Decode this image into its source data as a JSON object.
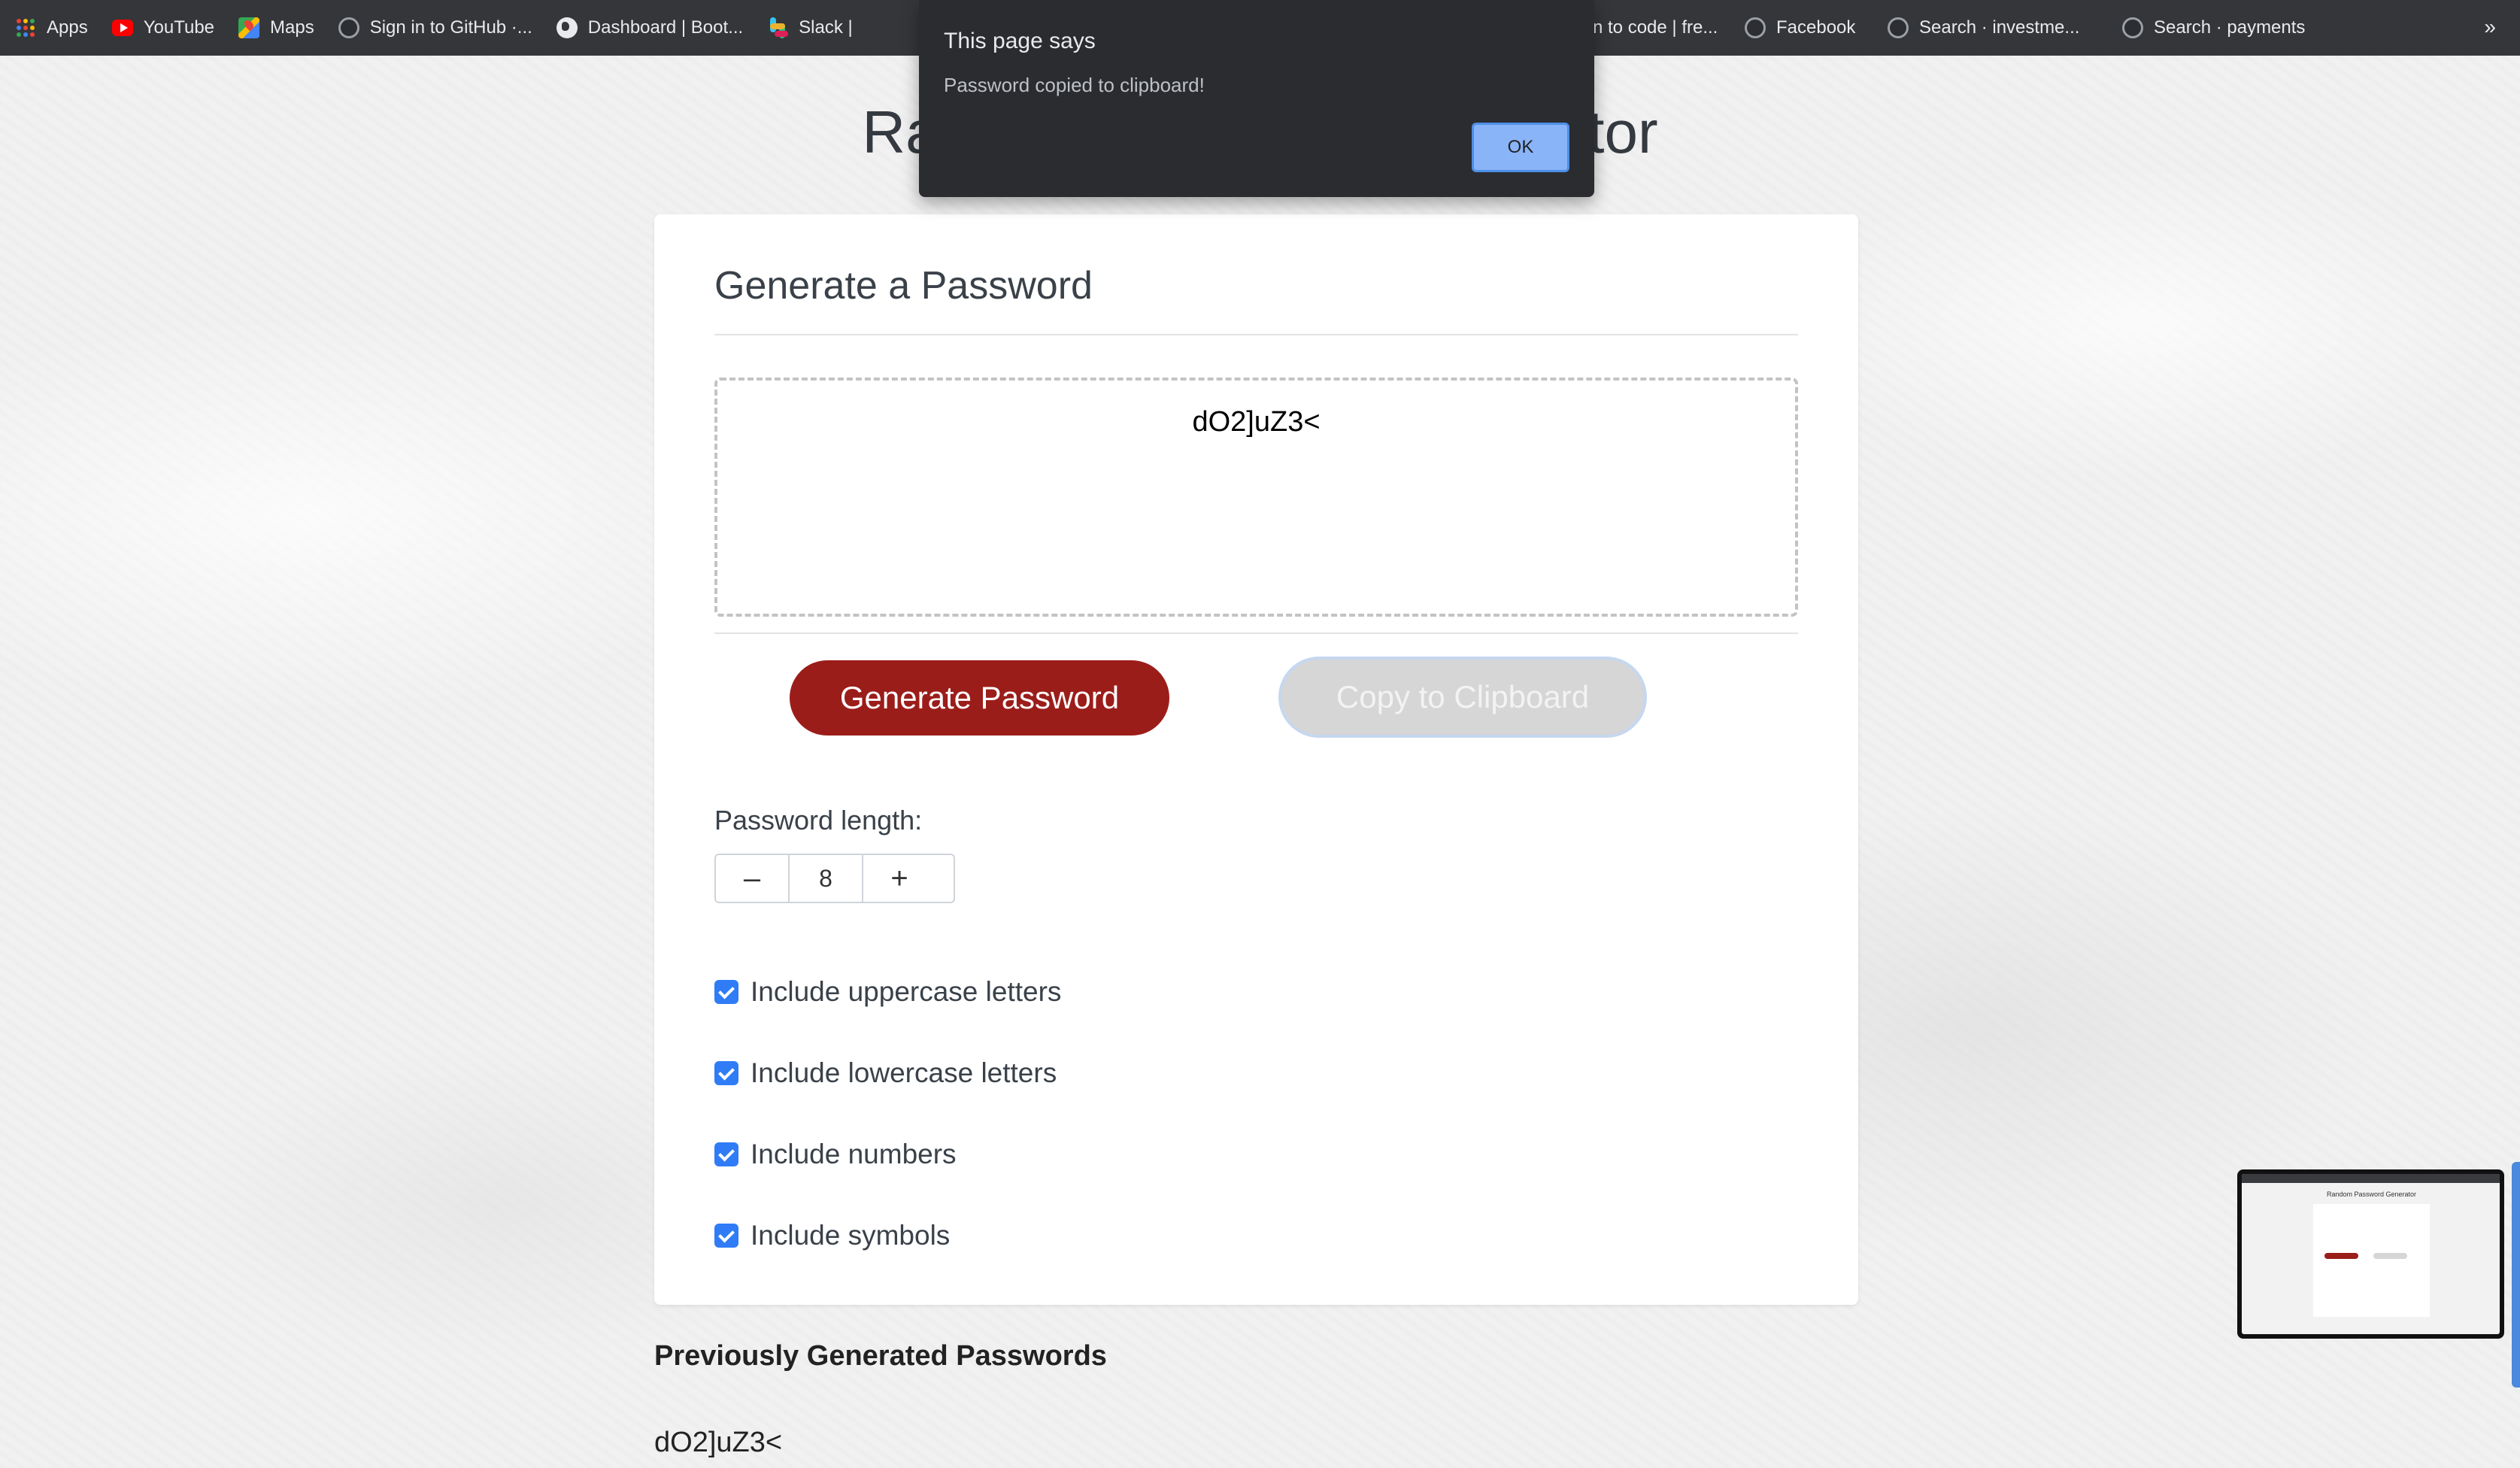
{
  "bookmarks": [
    {
      "label": "Apps",
      "icon": "apps-grid-icon"
    },
    {
      "label": "YouTube",
      "icon": "youtube-icon"
    },
    {
      "label": "Maps",
      "icon": "maps-icon"
    },
    {
      "label": "Sign in to GitHub ·...",
      "icon": "github-icon"
    },
    {
      "label": "Dashboard | Boot...",
      "icon": "globe-icon"
    },
    {
      "label": "Slack |",
      "icon": "slack-icon"
    },
    {
      "label": "n to code | fre...",
      "icon": "github-icon"
    },
    {
      "label": "Facebook",
      "icon": "github-icon"
    },
    {
      "label": "Search · investme...",
      "icon": "github-icon"
    },
    {
      "label": "Search · payments",
      "icon": "github-icon"
    }
  ],
  "bookmarks_more": "»",
  "page": {
    "title": "Random Password Generator"
  },
  "card": {
    "title": "Generate a Password",
    "generated_password": "dO2]uZ3<",
    "generate_button": "Generate Password",
    "copy_button": "Copy to Clipboard",
    "length_label": "Password length:",
    "length_value": "8",
    "minus": "–",
    "plus": "+",
    "options": [
      {
        "label": "Include uppercase letters",
        "checked": true
      },
      {
        "label": "Include lowercase letters",
        "checked": true
      },
      {
        "label": "Include numbers",
        "checked": true
      },
      {
        "label": "Include symbols",
        "checked": true
      }
    ]
  },
  "history": {
    "title": "Previously Generated Passwords",
    "items": [
      "dO2]uZ3<"
    ]
  },
  "dialog": {
    "title": "This page says",
    "message": "Password copied to clipboard!",
    "ok_label": "OK"
  },
  "thumbnail": {
    "title": "Random Password Generator"
  },
  "colors": {
    "generate_button": "#9b1d1a",
    "copy_button_disabled": "#d6d6d6",
    "checkbox": "#2f7cf6",
    "dialog_bg": "#2b2c2f",
    "dialog_ok": "#8ab4f8",
    "bookmarks_bar": "#35363a"
  }
}
